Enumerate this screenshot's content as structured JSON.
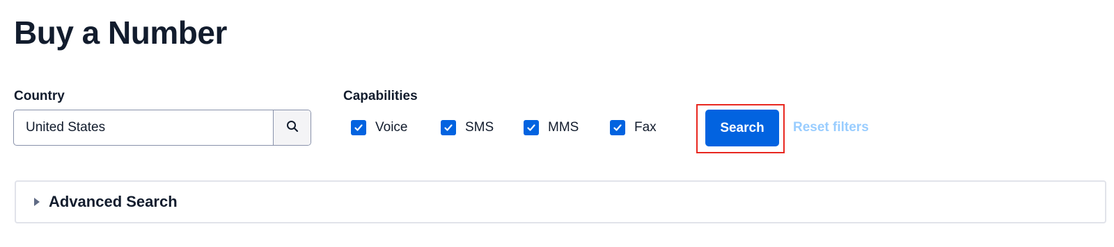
{
  "page": {
    "title": "Buy a Number"
  },
  "country": {
    "label": "Country",
    "value": "United States",
    "search_icon": "search-icon"
  },
  "capabilities": {
    "label": "Capabilities",
    "options": [
      {
        "label": "Voice",
        "checked": true
      },
      {
        "label": "SMS",
        "checked": true
      },
      {
        "label": "MMS",
        "checked": true
      },
      {
        "label": "Fax",
        "checked": true
      }
    ]
  },
  "actions": {
    "search_label": "Search",
    "reset_label": "Reset filters"
  },
  "advanced": {
    "title": "Advanced Search",
    "expanded": false,
    "icon": "caret-right-icon"
  },
  "colors": {
    "primary": "#0263e0",
    "text": "#121c2d",
    "reset_link": "#99cdff",
    "highlight": "#e8271f",
    "border": "#8891aa"
  }
}
